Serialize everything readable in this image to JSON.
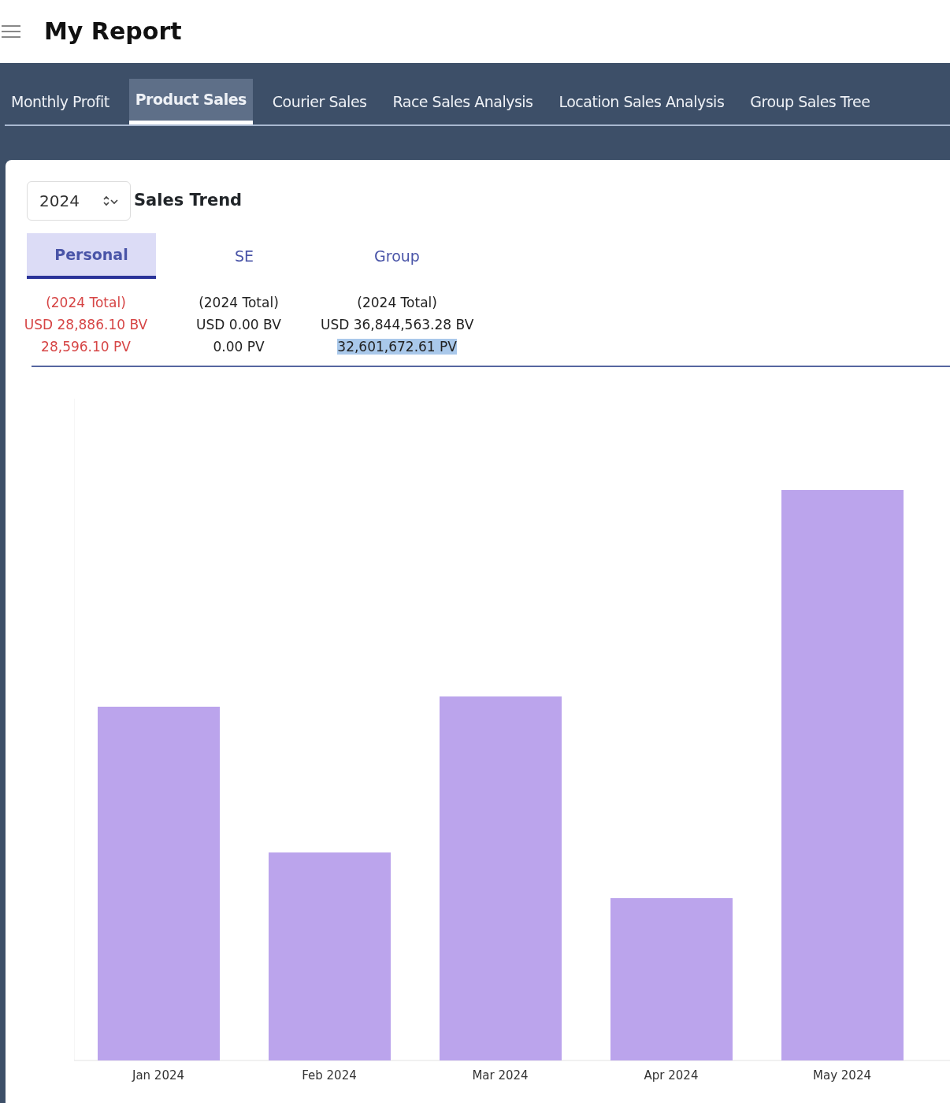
{
  "header": {
    "title": "My Report"
  },
  "tabs": [
    {
      "label": "Monthly Profit",
      "selected": false
    },
    {
      "label": "Product Sales",
      "selected": true
    },
    {
      "label": "Courier Sales",
      "selected": false
    },
    {
      "label": "Race Sales Analysis",
      "selected": false
    },
    {
      "label": "Location Sales Analysis",
      "selected": false
    },
    {
      "label": "Group Sales Tree",
      "selected": false
    }
  ],
  "year_select": {
    "value": "2024"
  },
  "section_title": "Sales Trend",
  "sub_tabs": [
    {
      "label": "Personal",
      "selected": true,
      "totals": [
        {
          "text": "(2024 Total)",
          "selected": false
        },
        {
          "text": "USD 28,886.10 BV",
          "selected": false
        },
        {
          "text": "28,596.10 PV",
          "selected": false
        }
      ]
    },
    {
      "label": "SE",
      "selected": false,
      "totals": [
        {
          "text": "(2024 Total)",
          "selected": false
        },
        {
          "text": "USD 0.00 BV",
          "selected": false
        },
        {
          "text": "0.00 PV",
          "selected": false
        }
      ]
    },
    {
      "label": "Group",
      "selected": false,
      "totals": [
        {
          "text": "(2024 Total)",
          "selected": false
        },
        {
          "text": "USD 36,844,563.28 BV",
          "selected": false
        },
        {
          "text": "32,601,672.61 PV",
          "selected": true
        }
      ]
    }
  ],
  "chart": {
    "x_labels": [
      "Jan 2024",
      "Feb 2024",
      "Mar 2024",
      "Apr 2024",
      "May 2024"
    ]
  }
}
